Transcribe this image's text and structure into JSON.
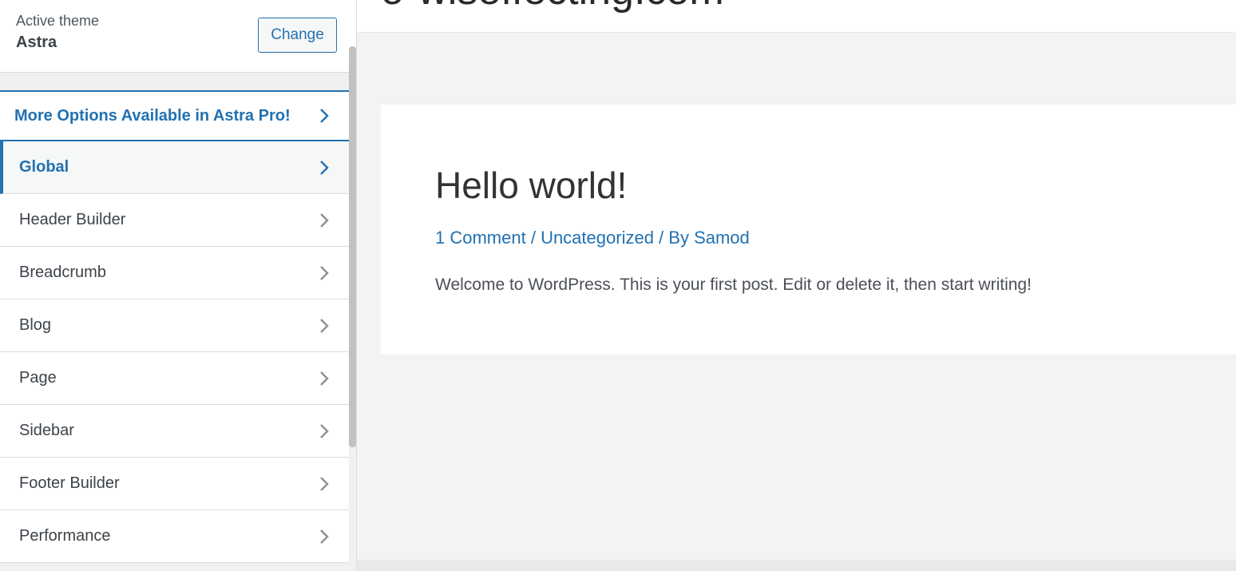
{
  "theme": {
    "label": "Active theme",
    "name": "Astra",
    "change_label": "Change"
  },
  "menu": {
    "promo_label": "More Options Available in Astra Pro!",
    "items": [
      {
        "label": "Global",
        "active": true
      },
      {
        "label": "Header Builder"
      },
      {
        "label": "Breadcrumb"
      },
      {
        "label": "Blog"
      },
      {
        "label": "Page"
      },
      {
        "label": "Sidebar"
      },
      {
        "label": "Footer Builder"
      },
      {
        "label": "Performance"
      }
    ]
  },
  "preview": {
    "site_title": "o-wiseffecting.com",
    "post": {
      "title": "Hello world!",
      "meta_comment": "1 Comment",
      "meta_sep1": " / ",
      "meta_category": "Uncategorized",
      "meta_sep2": " / By ",
      "meta_author": "Samod",
      "excerpt": "Welcome to WordPress. This is your first post. Edit or delete it, then start writing!"
    }
  },
  "colors": {
    "accent": "#2271b1",
    "text": "#3c434a",
    "chevron": "#8c8f94",
    "preview_bg": "#f3f3f3"
  }
}
